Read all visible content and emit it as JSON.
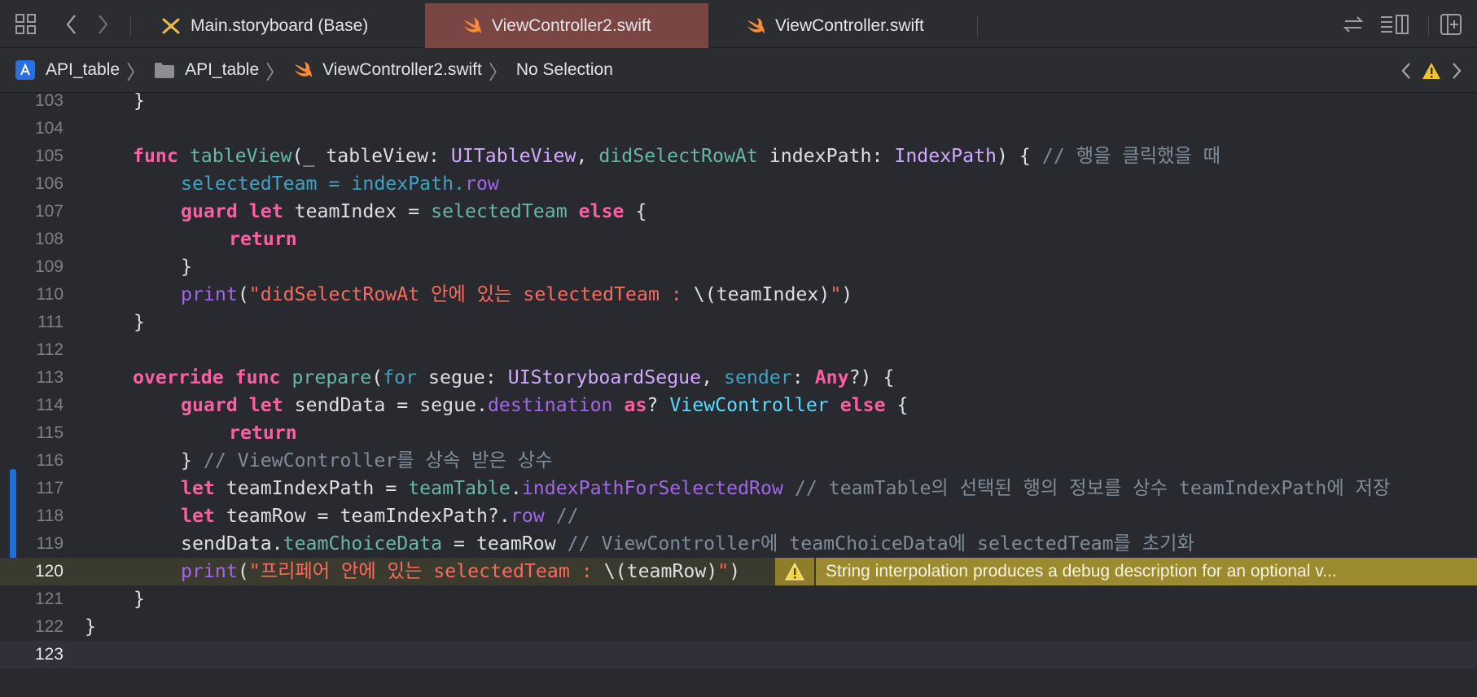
{
  "tabs": [
    {
      "label": "Main.storyboard (Base)",
      "icon": "storyboard-icon",
      "active": false
    },
    {
      "label": "ViewController2.swift",
      "icon": "swift-file-icon",
      "active": true
    },
    {
      "label": "ViewController.swift",
      "icon": "swift-file-icon",
      "active": false
    }
  ],
  "breadcrumb": {
    "project": "API_table",
    "folder": "API_table",
    "file": "ViewController2.swift",
    "selection": "No Selection"
  },
  "editor": {
    "lines": [
      {
        "n": "103"
      },
      {
        "n": "104"
      },
      {
        "n": "105"
      },
      {
        "n": "106"
      },
      {
        "n": "107"
      },
      {
        "n": "108"
      },
      {
        "n": "109"
      },
      {
        "n": "110"
      },
      {
        "n": "111"
      },
      {
        "n": "112"
      },
      {
        "n": "113"
      },
      {
        "n": "114"
      },
      {
        "n": "115"
      },
      {
        "n": "116"
      },
      {
        "n": "117"
      },
      {
        "n": "118"
      },
      {
        "n": "119"
      },
      {
        "n": "120"
      },
      {
        "n": "121"
      },
      {
        "n": "122"
      },
      {
        "n": "123"
      }
    ],
    "code": {
      "l103": "}",
      "l105_func": "func",
      "l105_name": "tableView",
      "l105_a": "(_ tableView: ",
      "l105_type1": "UITableView",
      "l105_b": ", ",
      "l105_label": "didSelectRowAt",
      "l105_c": " indexPath: ",
      "l105_type2": "IndexPath",
      "l105_d": ") { ",
      "l105_comment": "// 행을 클릭했을 때",
      "l106_a": "selectedTeam = indexPath.",
      "l106_prop": "row",
      "l107_guard": "guard",
      "l107_let": "let",
      "l107_a": " teamIndex = ",
      "l107_var": "selectedTeam",
      "l107_else": "else",
      "l107_b": " {",
      "l108_return": "return",
      "l109": "}",
      "l110_print": "print",
      "l110_a": "(",
      "l110_str": "\"didSelectRowAt 안에 있는 selectedTeam : ",
      "l110_interp": "\\(teamIndex)",
      "l110_strend": "\"",
      "l110_b": ")",
      "l111": "}",
      "l113_override": "override",
      "l113_func": "func",
      "l113_name": "prepare",
      "l113_a": "(",
      "l113_for": "for",
      "l113_b": " segue: ",
      "l113_type": "UIStoryboardSegue",
      "l113_c": ", ",
      "l113_sender": "sender",
      "l113_d": ": ",
      "l113_any": "Any",
      "l113_e": "?) {",
      "l114_guard": "guard",
      "l114_let": "let",
      "l114_a": " sendData = segue.",
      "l114_prop": "destination",
      "l114_as": "as",
      "l114_b": "? ",
      "l114_cls": "ViewController",
      "l114_else": "else",
      "l114_c": " {",
      "l115_return": "return",
      "l116_a": "} ",
      "l116_comment": "// ViewController를 상속 받은 상수",
      "l117_let": "let",
      "l117_a": " teamIndexPath = ",
      "l117_var": "teamTable",
      "l117_dot": ".",
      "l117_prop": "indexPathForSelectedRow",
      "l117_comment": " // teamTable의 선택된 행의 정보를 상수 teamIndexPath에 저장",
      "l118_let": "let",
      "l118_a": " teamRow = teamIndexPath?.",
      "l118_prop": "row",
      "l118_comment": " //",
      "l119_a": "sendData.",
      "l119_prop": "teamChoiceData",
      "l119_b": " = teamRow ",
      "l119_comment": "// ViewController에 teamChoiceData에 selectedTeam를 초기화",
      "l120_print": "print",
      "l120_a": "(",
      "l120_str": "\"프리페어 안에 있는 selectedTeam : ",
      "l120_interp": "\\(teamRow)",
      "l120_strend": "\"",
      "l120_b": ")",
      "l121": "}",
      "l122": "}"
    },
    "warning": {
      "message": "String interpolation produces a debug description for an optional v..."
    }
  },
  "colors": {
    "active_tab": "#7a4644",
    "keyword": "#fc5fa3",
    "string": "#fc6a5d",
    "comment": "#7f8c98",
    "warning": "#9c8b2e"
  }
}
